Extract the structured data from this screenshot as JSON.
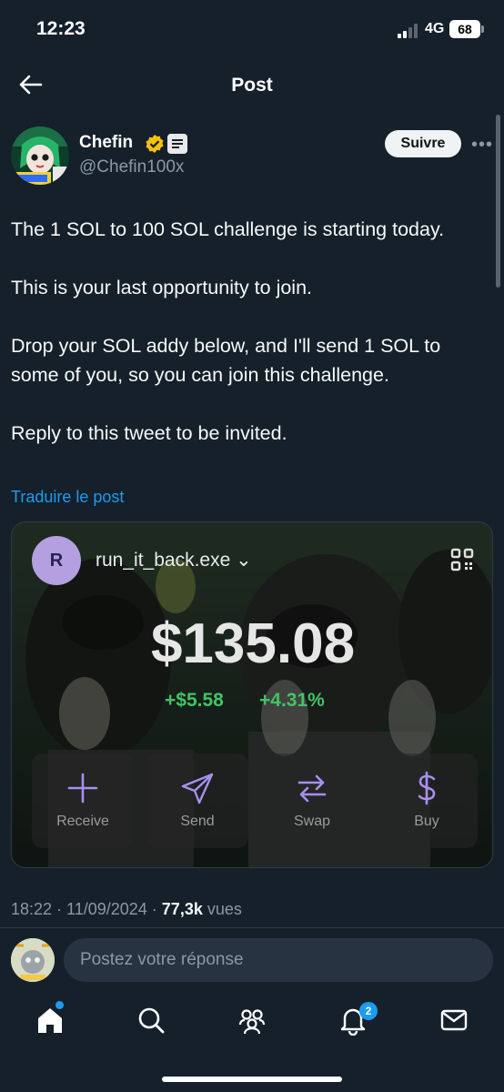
{
  "status_bar": {
    "time": "12:23",
    "network": "4G",
    "battery": "68"
  },
  "header": {
    "title": "Post",
    "back_icon": "arrow-left-icon"
  },
  "author": {
    "name": "Chefin",
    "handle": "@Chefin100x",
    "verified_color": "#f4c20d",
    "follow_label": "Suivre"
  },
  "post": {
    "paragraphs": [
      "The 1 SOL to 100 SOL challenge is starting today.",
      "This is your last opportunity to join.",
      "Drop your SOL addy below, and I'll send 1 SOL to some of you, so you can join this challenge.",
      "Reply to this tweet to be invited."
    ],
    "translate_link": "Traduire le post"
  },
  "wallet": {
    "avatar_letter": "R",
    "account_name": "run_it_back.exe",
    "balance": "$135.08",
    "change_usd": "+$5.58",
    "change_pct": "+4.31%",
    "accent_green": "#40c466",
    "actions": [
      {
        "label": "Receive",
        "icon": "plus-icon"
      },
      {
        "label": "Send",
        "icon": "send-icon"
      },
      {
        "label": "Swap",
        "icon": "swap-icon"
      },
      {
        "label": "Buy",
        "icon": "dollar-icon"
      }
    ]
  },
  "meta": {
    "time_date": "18:22 · 11/09/2024 · ",
    "views_count": "77,3k",
    "views_label": " vues"
  },
  "reply": {
    "placeholder": "Postez votre réponse"
  },
  "nav": {
    "notifications_count": "2",
    "items": [
      "home-icon",
      "search-icon",
      "communities-icon",
      "notifications-icon",
      "messages-icon"
    ]
  },
  "colors": {
    "background": "#15202b",
    "link": "#1d9bf0",
    "muted": "#8b98a5"
  }
}
